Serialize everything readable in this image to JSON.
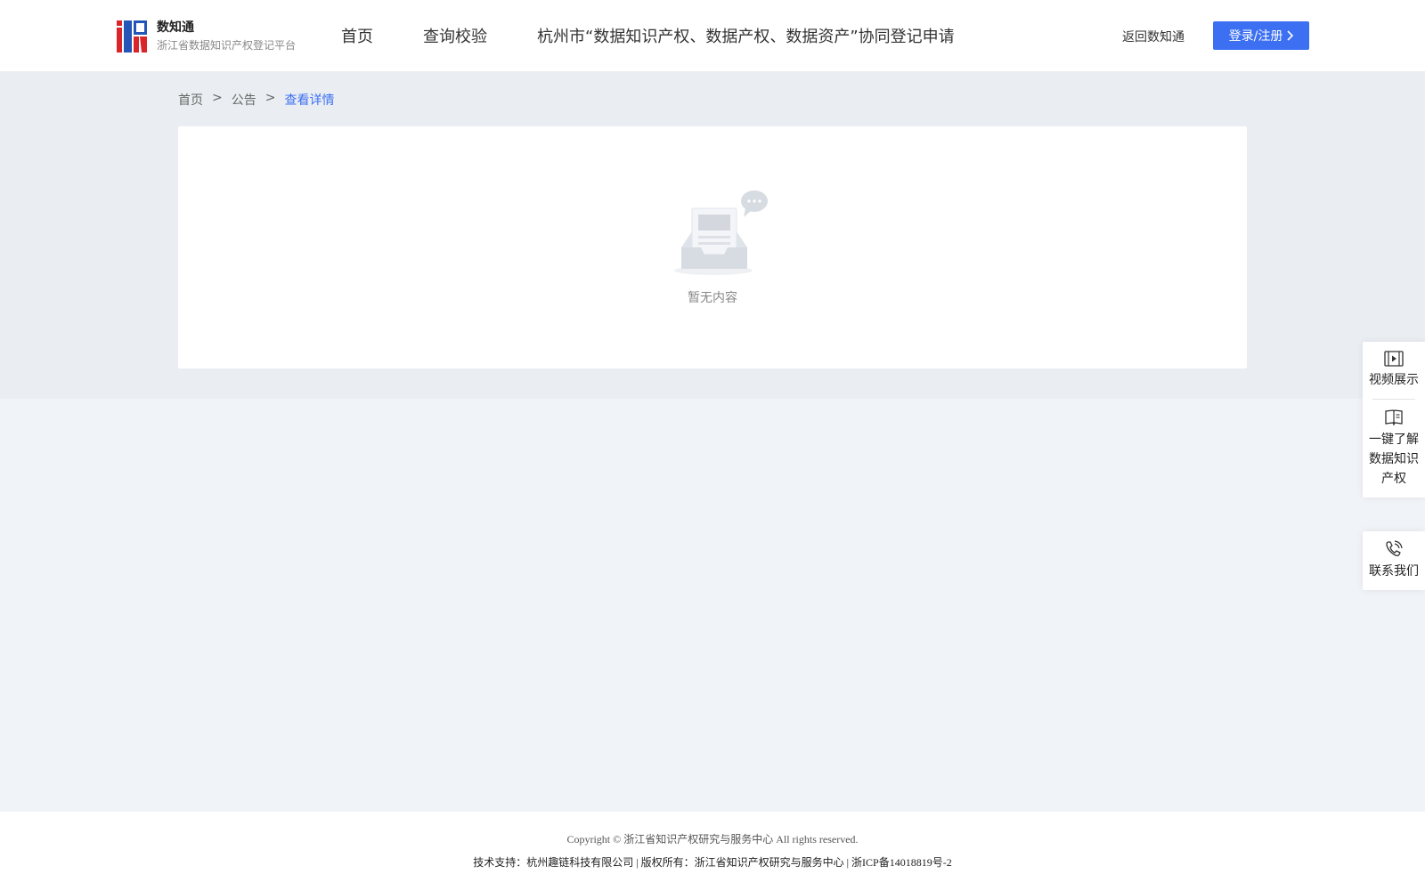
{
  "header": {
    "logo_title": "数知通",
    "logo_subtitle": "浙江省数据知识产权登记平台",
    "nav": [
      "首页",
      "查询校验",
      "杭州市“数据知识产权、数据产权、数据资产”协同登记申请"
    ],
    "back_link": "返回数知通",
    "login_label": "登录/注册"
  },
  "breadcrumb": {
    "items": [
      "首页",
      "公告"
    ],
    "separator": ">",
    "current": "查看详情"
  },
  "main": {
    "empty_text": "暂无内容"
  },
  "side_panel": {
    "video": "视频展示",
    "learn_lines": [
      "一键了解",
      "数据知识",
      "产权"
    ],
    "contact": "联系我们"
  },
  "footer": {
    "line1": "Copyright © 浙江省知识产权研究与服务中心 All rights reserved.",
    "line2": "技术支持：杭州趣链科技有限公司 | 版权所有：浙江省知识产权研究与服务中心 | 浙ICP备14018819号-2"
  },
  "colors": {
    "accent": "#3c6ff2",
    "page_bg": "#f0f3f7"
  },
  "icons": [
    "logo-icon",
    "chevron-right-icon",
    "empty-inbox-icon",
    "video-icon",
    "book-icon",
    "phone-icon"
  ]
}
